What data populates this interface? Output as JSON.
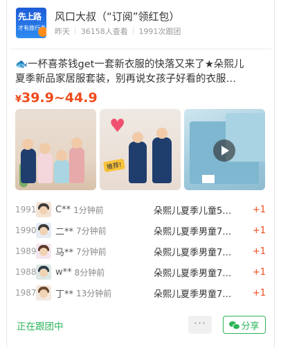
{
  "header": {
    "logo_line1": "先上路",
    "logo_line2": "才有旅行者",
    "title": "风口大叔（“订阅”领红包）",
    "meta": [
      "昨天",
      "36158人查看",
      "1991次跟团"
    ]
  },
  "post": {
    "line1": "🐟一杯喜茶钱get一套新衣服的快落又来了★朵熙儿",
    "line2": "夏季新品家居服套装，别再说女孩子好看的衣服…",
    "price_symbol": "¥",
    "price_range": "39.9~44.9",
    "thumb2_tag": "推荐!"
  },
  "followers": [
    {
      "num": "1991",
      "name": "C**",
      "time": "1分钟前",
      "product": "朵熙儿夏季儿童5…",
      "plus": "+1"
    },
    {
      "num": "1990",
      "name": "二**",
      "time": "7分钟前",
      "product": "朵熙儿夏季男童7…",
      "plus": "+1"
    },
    {
      "num": "1989",
      "name": "马**",
      "time": "7分钟前",
      "product": "朵熙儿夏季男童7…",
      "plus": "+1"
    },
    {
      "num": "1988",
      "name": "w**",
      "time": "8分钟前",
      "product": "朵熙儿夏季男童7…",
      "plus": "+1"
    },
    {
      "num": "1987",
      "name": "丁**",
      "time": "13分钟前",
      "product": "朵熙儿夏季男童7…",
      "plus": "+1"
    }
  ],
  "footer": {
    "status": "正在跟团中",
    "more": "···",
    "share": "分享"
  },
  "colors": {
    "accent_green": "#2db45a",
    "price_red": "#f04a1a"
  }
}
